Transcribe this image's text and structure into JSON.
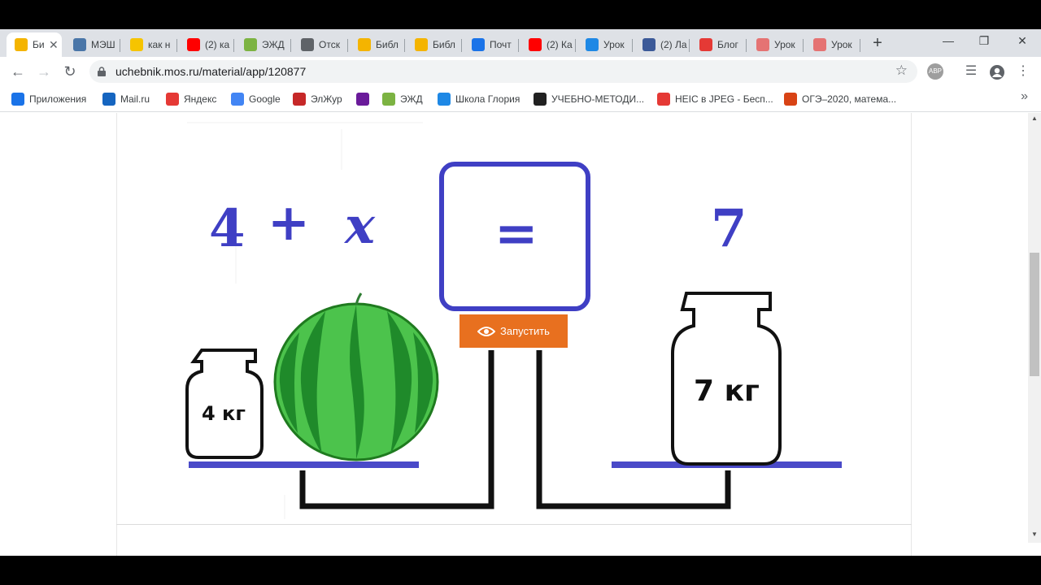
{
  "browser": {
    "tabs": [
      {
        "title": "Би",
        "icon": "book-icon",
        "color": "#f4b400",
        "active": true
      },
      {
        "title": "МЭШ",
        "icon": "vk-icon",
        "color": "#4a76a8"
      },
      {
        "title": "как н",
        "icon": "play-icon",
        "color": "#f6c400"
      },
      {
        "title": "(2) ка",
        "icon": "youtube-icon",
        "color": "#ff0000"
      },
      {
        "title": "ЭЖД",
        "icon": "journal-icon",
        "color": "#7cb342"
      },
      {
        "title": "Отск",
        "icon": "globe-icon",
        "color": "#5f6368"
      },
      {
        "title": "Библ",
        "icon": "book-icon",
        "color": "#f4b400"
      },
      {
        "title": "Библ",
        "icon": "book-icon",
        "color": "#f4b400"
      },
      {
        "title": "Почт",
        "icon": "mail-icon",
        "color": "#1a73e8"
      },
      {
        "title": "(2) Ка",
        "icon": "youtube-icon",
        "color": "#ff0000"
      },
      {
        "title": "Урок",
        "icon": "book-blue-icon",
        "color": "#1e88e5"
      },
      {
        "title": "(2) Ла",
        "icon": "facebook-icon",
        "color": "#3b5998"
      },
      {
        "title": "Блог",
        "icon": "blog-icon",
        "color": "#e53935"
      },
      {
        "title": "Урок",
        "icon": "lesson-icon",
        "color": "#e57373"
      },
      {
        "title": "Урок",
        "icon": "lesson-icon",
        "color": "#e57373"
      }
    ],
    "new_tab": "+",
    "url": "uchebnik.mos.ru/material/app/120877",
    "abp_label": "ABP"
  },
  "bookmarks": [
    {
      "label": "Приложения",
      "icon": "apps-icon",
      "color": "#1a73e8"
    },
    {
      "label": "Mail.ru",
      "icon": "mailru-icon",
      "color": "#1565c0"
    },
    {
      "label": "Яндекс",
      "icon": "yandex-icon",
      "color": "#e53935"
    },
    {
      "label": "Google",
      "icon": "google-icon",
      "color": "#4285f4"
    },
    {
      "label": "ЭлЖур",
      "icon": "elzhur-icon",
      "color": "#c62828"
    },
    {
      "label": "",
      "icon": "pawn-icon",
      "color": "#6a1b9a"
    },
    {
      "label": "ЭЖД",
      "icon": "journal-icon",
      "color": "#7cb342"
    },
    {
      "label": "Школа Глория",
      "icon": "school-icon",
      "color": "#1e88e5"
    },
    {
      "label": "УЧЕБНО-МЕТОДИ...",
      "icon": "graduation-cap-icon",
      "color": "#212121"
    },
    {
      "label": "HEIC в JPEG - Бесп...",
      "icon": "heic-icon",
      "color": "#e53935"
    },
    {
      "label": "ОГЭ–2020, матема...",
      "icon": "oge-icon",
      "color": "#d84315"
    }
  ],
  "equation": {
    "left_number": "4",
    "plus": "+",
    "variable": "x",
    "sign": "=",
    "right_number": "7"
  },
  "run_button_label": "Запустить",
  "left_weight_label": "4 кг",
  "right_weight_label": "7 кг",
  "colors": {
    "equation_blue": "#3f3fc4",
    "pan_blue": "#4a4ac8",
    "button_orange": "#e8701f",
    "melon_green": "#2e9e2e"
  }
}
